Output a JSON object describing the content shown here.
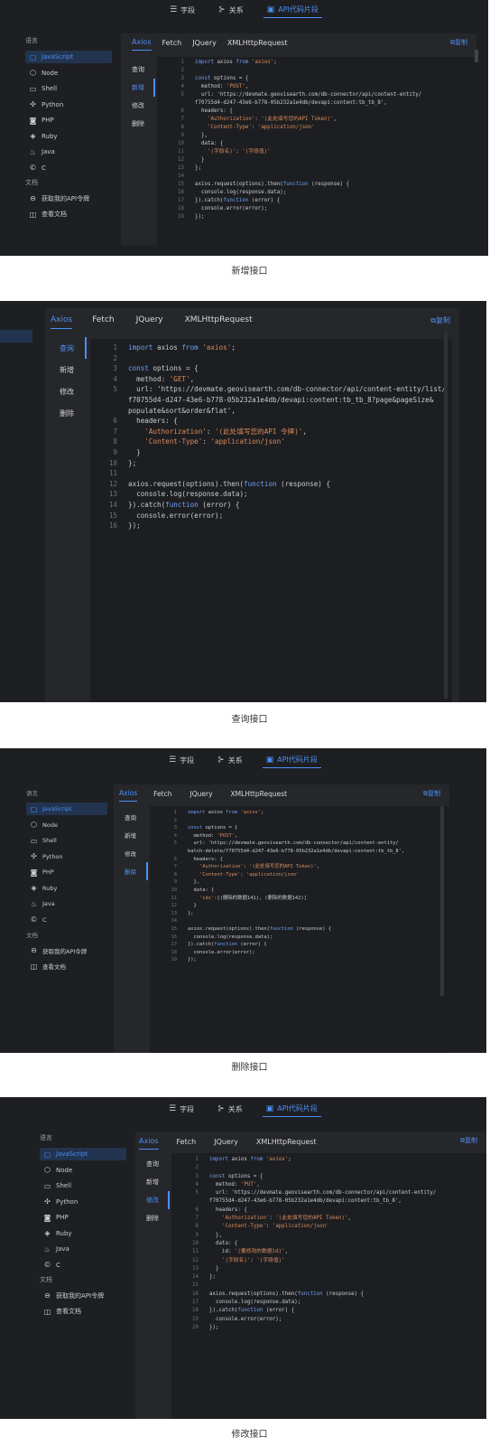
{
  "top_tabs": [
    "字段",
    "关系",
    "API代码片段"
  ],
  "languages_heading": "语言",
  "languages": [
    "JavaScript",
    "Node",
    "Shell",
    "Python",
    "PHP",
    "Ruby",
    "Java",
    "C"
  ],
  "docs_heading": "文档",
  "docs_links": [
    "获取我的API令牌",
    "查看文档"
  ],
  "lib_tabs": [
    "Axios",
    "Fetch",
    "JQuery",
    "XMLHttpRequest"
  ],
  "copy_label": "复制",
  "methods": [
    "查询",
    "新增",
    "修改",
    "删除"
  ],
  "captions": [
    "新增接口",
    "查询接口",
    "删除接口",
    "修改接口"
  ],
  "snippets": [
    [
      "import axios from 'axios';",
      "",
      "const options = {",
      "  method: 'POST',",
      "  url: 'https://devmate.geovisearth.com/db-connector/api/content-entity/",
      "f70755d4-d247-43e6-b778-05b232a1e4db/devapi:content:tb_tb_8',",
      "  headers: {",
      "    'Authorization': '(此处填写您的API Token)',",
      "    'Content-Type': 'application/json'",
      "  },",
      "  data: {",
      "    '(字段名)': '(字段值)'",
      "  }",
      "};",
      "",
      "axios.request(options).then(function (response) {",
      "  console.log(response.data);",
      "}).catch(function (error) {",
      "  console.error(error);",
      "});"
    ],
    [
      "import axios from 'axios';",
      "",
      "const options = {",
      "  method: 'GET',",
      "  url: 'https://devmate.geovisearth.com/db-connector/api/content-entity/list/",
      "f70755d4-d247-43e6-b778-05b232a1e4db/devapi:content:tb_tb_8?page&pageSize&",
      "populate&sort&order&flat',",
      "  headers: {",
      "    'Authorization': '(此处填写您的API 令牌)',",
      "    'Content-Type': 'application/json'",
      "  }",
      "};",
      "",
      "axios.request(options).then(function (response) {",
      "  console.log(response.data);",
      "}).catch(function (error) {",
      "  console.error(error);",
      "});"
    ],
    [
      "import axios from 'axios';",
      "",
      "const options = {",
      "  method: 'POST',",
      "  url: 'https://devmate.geovisearth.com/db-connector/api/content-entity/",
      "batch-delete/f70755d4-d247-43e6-b778-05b232a1e4db/devapi:content:tb_tb_8',",
      "  headers: {",
      "    'Authorization': '(此处填写您的API Token)',",
      "    'Content-Type': 'application/json'",
      "  },",
      "  data: {",
      "    'ids':[(删除的数据141), (删除的数据142)]",
      "  }",
      "};",
      "",
      "axios.request(options).then(function (response) {",
      "  console.log(response.data);",
      "}).catch(function (error) {",
      "  console.error(error);",
      "});"
    ],
    [
      "import axios from 'axios';",
      "",
      "const options = {",
      "  method: 'PUT',",
      "  url: 'https://devmate.geovisearth.com/db-connector/api/content-entity/",
      "f70755d4-d247-43e6-b778-05b232a1e4db/devapi:content:tb_tb_8',",
      "  headers: {",
      "    'Authorization': '(此处填写您的API Token)',",
      "    'Content-Type': 'application/json'",
      "  },",
      "  data: {",
      "    id: '(要修改的数据id)',",
      "    '(字段名)': '(字段值)'",
      "  }",
      "};",
      "",
      "axios.request(options).then(function (response) {",
      "  console.log(response.data);",
      "}).catch(function (error) {",
      "  console.error(error);",
      "});"
    ]
  ],
  "line_numbers": [
    [
      "1",
      "2",
      "3",
      "4",
      "5",
      "",
      "6",
      "7",
      "8",
      "9",
      "10",
      "11",
      "12",
      "13",
      "14",
      "15",
      "16",
      "17",
      "18",
      "19"
    ],
    [
      "1",
      "2",
      "3",
      "4",
      "5",
      "",
      "",
      "6",
      "7",
      "8",
      "9",
      "10",
      "11",
      "12",
      "13",
      "14",
      "15",
      "16"
    ],
    [
      "1",
      "2",
      "3",
      "4",
      "5",
      "",
      "6",
      "7",
      "8",
      "9",
      "10",
      "11",
      "12",
      "13",
      "14",
      "15",
      "16",
      "17",
      "18",
      "19"
    ],
    [
      "1",
      "2",
      "3",
      "4",
      "5",
      "",
      "6",
      "7",
      "8",
      "9",
      "10",
      "11",
      "12",
      "13",
      "14",
      "15",
      "16",
      "17",
      "18",
      "19",
      "20"
    ]
  ]
}
